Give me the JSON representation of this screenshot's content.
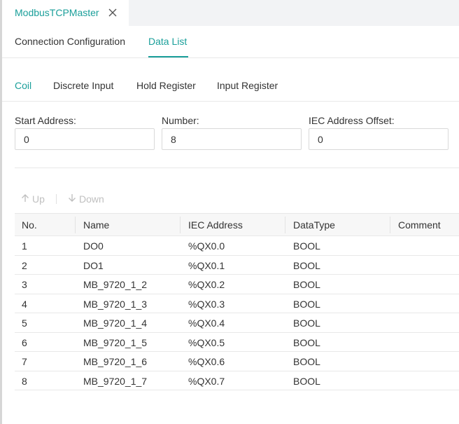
{
  "doc_tab": {
    "title": "ModbusTCPMaster",
    "close_icon": "close-icon"
  },
  "top_tabs": [
    {
      "label": "Connection Configuration"
    },
    {
      "label": "Data List",
      "active": true
    }
  ],
  "sub_tabs": [
    {
      "label": "Coil",
      "active": true
    },
    {
      "label": "Discrete Input"
    },
    {
      "label": "Hold Register"
    },
    {
      "label": "Input Register"
    }
  ],
  "form": {
    "start_address": {
      "label": "Start Address:",
      "value": "0"
    },
    "number": {
      "label": "Number:",
      "value": "8"
    },
    "iec_offset": {
      "label": "IEC Address Offset:",
      "value": "0"
    }
  },
  "toolbar": {
    "up_label": "Up",
    "up_icon": "arrow-up-icon",
    "down_label": "Down",
    "down_icon": "arrow-down-icon"
  },
  "table": {
    "columns": [
      "No.",
      "Name",
      "IEC Address",
      "DataType",
      "Comment"
    ],
    "rows": [
      {
        "no": "1",
        "name": "DO0",
        "iec": "%QX0.0",
        "type": "BOOL",
        "comment": ""
      },
      {
        "no": "2",
        "name": "DO1",
        "iec": "%QX0.1",
        "type": "BOOL",
        "comment": ""
      },
      {
        "no": "3",
        "name": "MB_9720_1_2",
        "iec": "%QX0.2",
        "type": "BOOL",
        "comment": ""
      },
      {
        "no": "4",
        "name": "MB_9720_1_3",
        "iec": "%QX0.3",
        "type": "BOOL",
        "comment": ""
      },
      {
        "no": "5",
        "name": "MB_9720_1_4",
        "iec": "%QX0.4",
        "type": "BOOL",
        "comment": ""
      },
      {
        "no": "6",
        "name": "MB_9720_1_5",
        "iec": "%QX0.5",
        "type": "BOOL",
        "comment": ""
      },
      {
        "no": "7",
        "name": "MB_9720_1_6",
        "iec": "%QX0.6",
        "type": "BOOL",
        "comment": ""
      },
      {
        "no": "8",
        "name": "MB_9720_1_7",
        "iec": "%QX0.7",
        "type": "BOOL",
        "comment": ""
      }
    ]
  },
  "colors": {
    "accent": "#1a9f9a",
    "text": "#333333",
    "border": "#e8e8e8",
    "disabled": "#c0c0c0",
    "tab_strip": "#f2f3f5",
    "header_bg": "#f7f7f7"
  }
}
